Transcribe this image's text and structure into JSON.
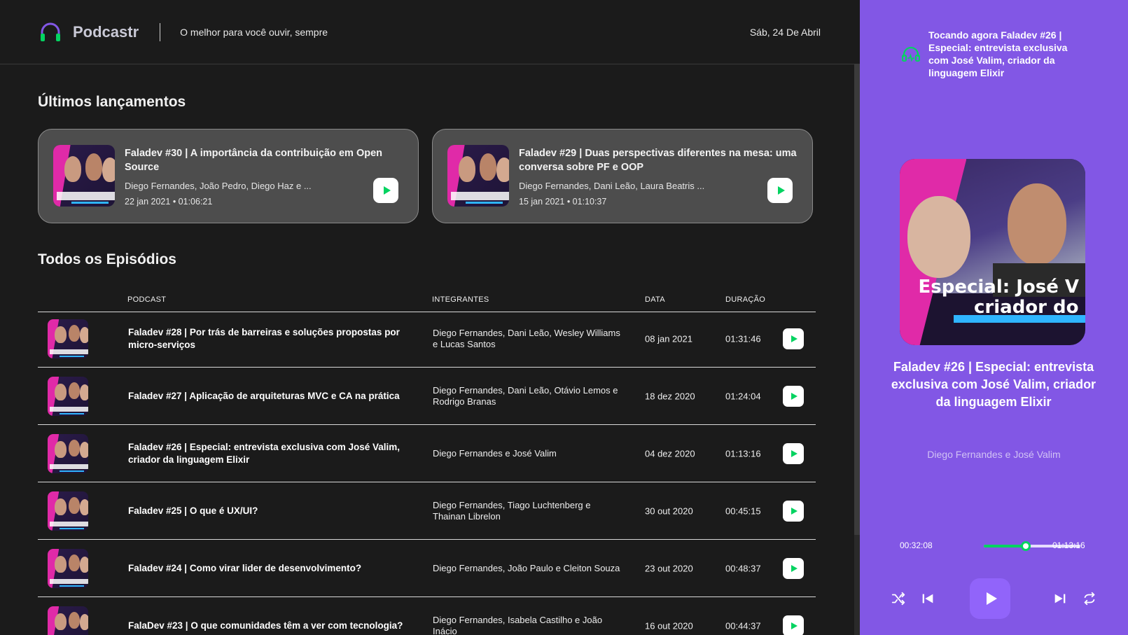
{
  "header": {
    "logo_text": "Podcastr",
    "tagline": "O melhor para você ouvir, sempre",
    "date": "Sáb, 24 De Abril"
  },
  "latest": {
    "title": "Últimos lançamentos",
    "items": [
      {
        "title": "Faladev #30 | A importância da contribuição em Open Source",
        "members": "Diego Fernandes, João Pedro, Diego Haz e ...",
        "date": "22 jan 2021",
        "duration": "01:06:21"
      },
      {
        "title": "Faladev #29 | Duas perspectivas diferentes na mesa: uma conversa sobre PF e OOP",
        "members": "Diego Fernandes, Dani Leão, Laura Beatris ...",
        "date": "15 jan 2021",
        "duration": "01:10:37"
      }
    ]
  },
  "all": {
    "title": "Todos os Episódios",
    "columns": {
      "podcast": "PODCAST",
      "members": "INTEGRANTES",
      "date": "DATA",
      "duration": "DURAÇÃO"
    },
    "rows": [
      {
        "title": "Faladev #28 | Por trás de barreiras e soluções propostas por micro-serviços",
        "members": "Diego Fernandes, Dani Leão, Wesley Williams e Lucas Santos",
        "date": "08 jan 2021",
        "duration": "01:31:46"
      },
      {
        "title": "Faladev #27 | Aplicação de arquiteturas MVC e CA na prática",
        "members": "Diego Fernandes, Dani Leão, Otávio Lemos e Rodrigo Branas",
        "date": "18 dez 2020",
        "duration": "01:24:04"
      },
      {
        "title": "Faladev #26 | Especial: entrevista exclusiva com José Valim, criador da linguagem Elixir",
        "members": "Diego Fernandes e José Valim",
        "date": "04 dez 2020",
        "duration": "01:13:16"
      },
      {
        "title": "Faladev #25 | O que é UX/UI?",
        "members": "Diego Fernandes, Tiago Luchtenberg e Thainan Librelon",
        "date": "30 out 2020",
        "duration": "00:45:15"
      },
      {
        "title": "Faladev #24 | Como virar lider de desenvolvimento?",
        "members": "Diego Fernandes, João Paulo e Cleiton Souza",
        "date": "23 out 2020",
        "duration": "00:48:37"
      },
      {
        "title": "FalaDev #23 | O que comunidades têm a ver com tecnologia?",
        "members": "Diego Fernandes, Isabela Castilho e João Inácio",
        "date": "16 out 2020",
        "duration": "00:44:37"
      }
    ]
  },
  "player": {
    "now_playing": "Tocando agora Faladev #26 | Especial: entrevista exclusiva com José Valim, criador da linguagem Elixir",
    "episode_title": "Faladev #26 | Especial: entrevista exclusiva com José Valim, criador da linguagem Elixir",
    "members": "Diego Fernandes e José Valim",
    "current_time": "00:32:08",
    "total_time": "01:13:16",
    "progress_fraction": 0.437,
    "cover_caption_1": "Especial: José V",
    "cover_caption_2": "criador do"
  },
  "colors": {
    "player_bg": "#8257e5",
    "accent_green": "#04d361",
    "main_bg": "#1b1b1b",
    "card_bg": "#4d4d4d"
  },
  "icons": {
    "logo": "headphones-icon",
    "now_playing": "headphones-icon",
    "shuffle": "shuffle-icon",
    "previous": "skip-previous-icon",
    "play": "play-icon",
    "next": "skip-next-icon",
    "repeat": "repeat-icon"
  }
}
